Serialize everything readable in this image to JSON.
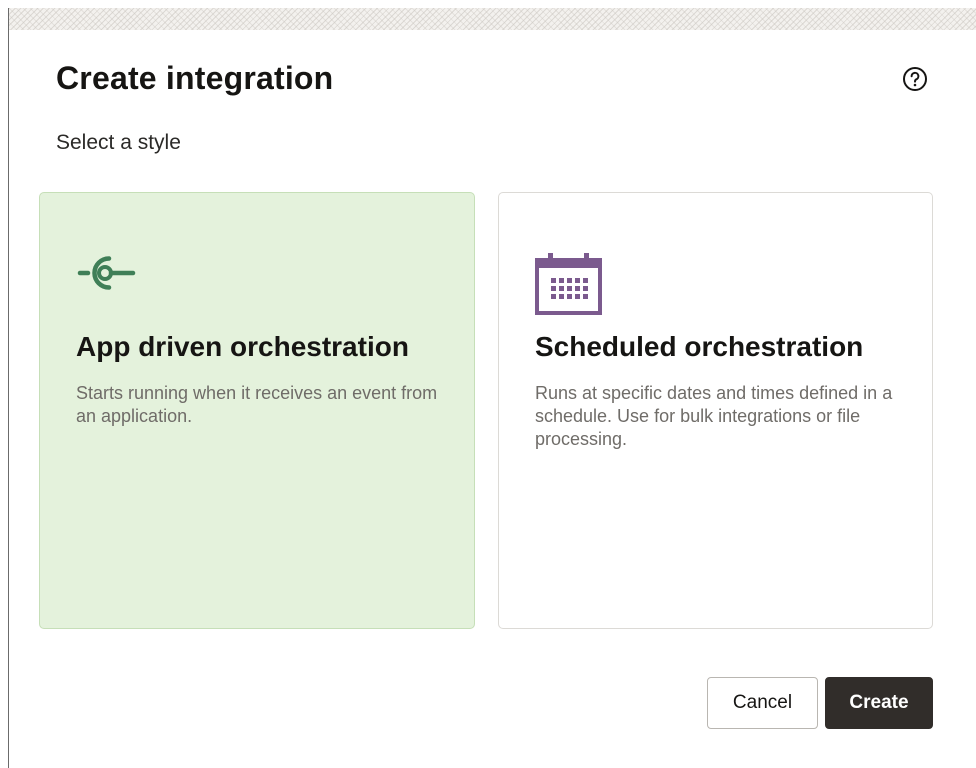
{
  "dialog": {
    "title": "Create integration",
    "subtitle": "Select a style",
    "help_icon": "help-circle-icon"
  },
  "cards": [
    {
      "title": "App driven orchestration",
      "description": "Starts running when it receives an event from an application.",
      "icon": "event-trigger-icon",
      "icon_color": "#3f7f57",
      "selected": true,
      "background": "#e4f2dc"
    },
    {
      "title": "Scheduled orchestration",
      "description": "Runs at specific dates and times defined in a schedule. Use for bulk integrations or file processing.",
      "icon": "calendar-icon",
      "icon_color": "#7b5a8e",
      "selected": false,
      "background": "#ffffff"
    }
  ],
  "buttons": {
    "cancel_label": "Cancel",
    "create_label": "Create",
    "create_color": "#312d2a"
  }
}
